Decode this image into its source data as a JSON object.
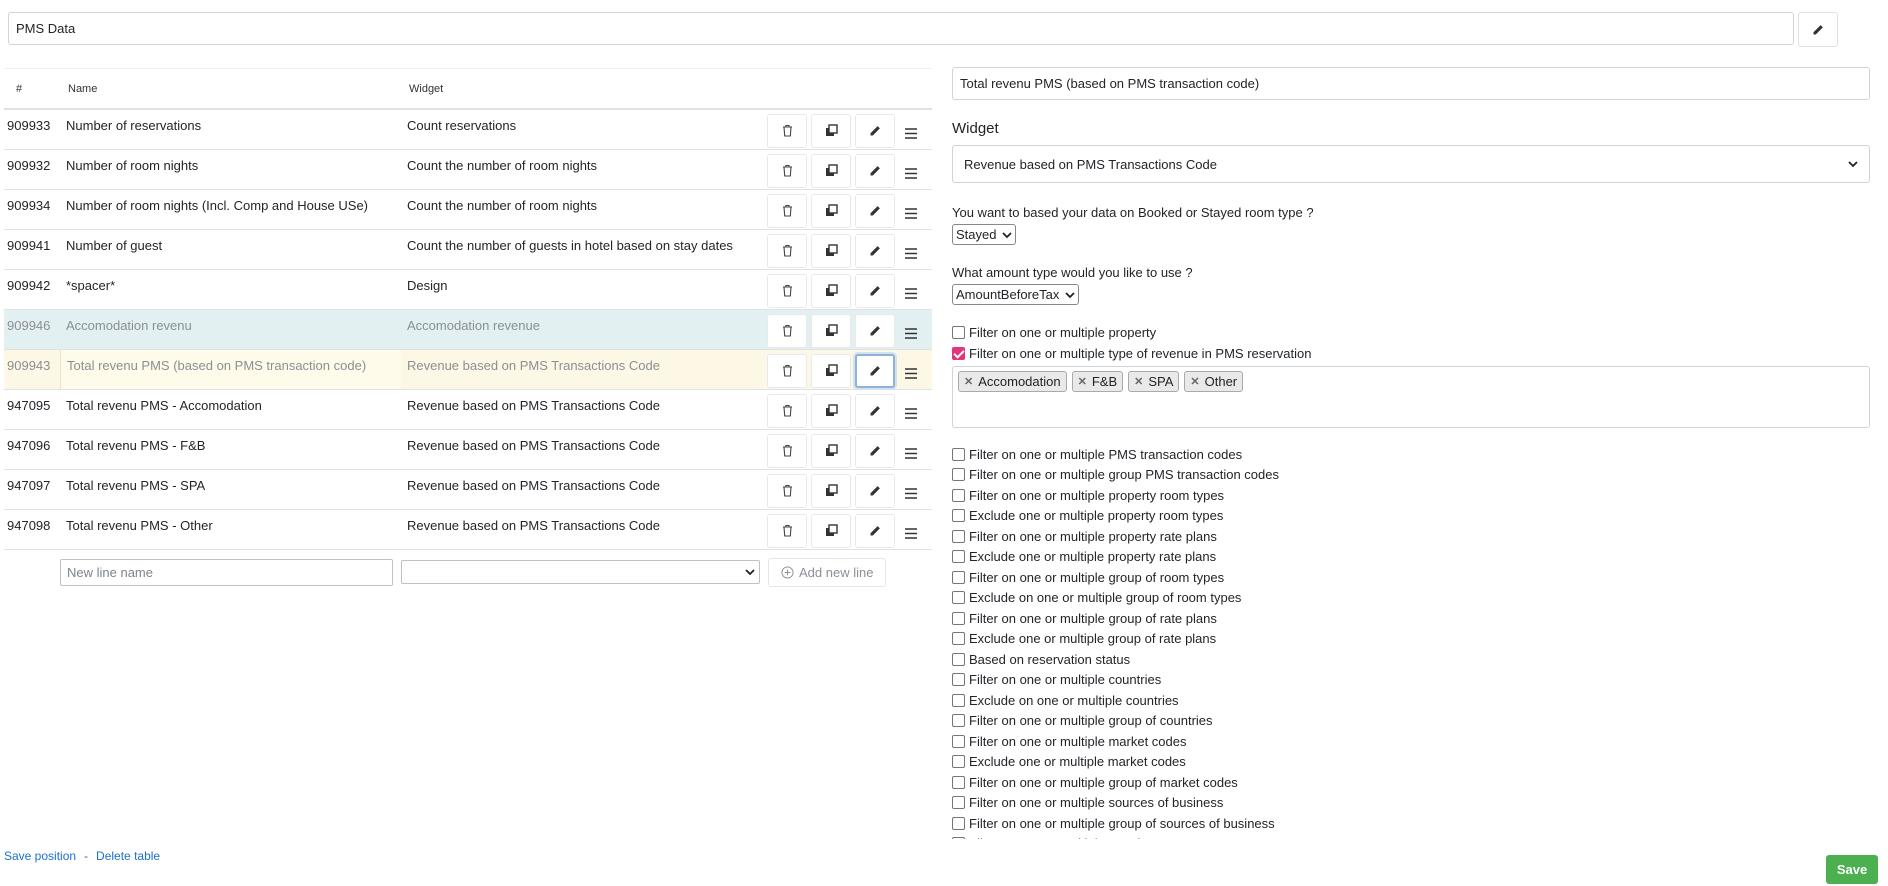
{
  "title": "PMS Data",
  "table": {
    "headers": {
      "id": "#",
      "name": "Name",
      "widget": "Widget"
    },
    "rows": [
      {
        "id": "909933",
        "name": "Number of reservations",
        "widget": "Count reservations",
        "state": ""
      },
      {
        "id": "909932",
        "name": "Number of room nights",
        "widget": "Count the number of room nights",
        "state": ""
      },
      {
        "id": "909934",
        "name": "Number of room nights (Incl. Comp and House USe)",
        "widget": "Count the number of room nights",
        "state": ""
      },
      {
        "id": "909941",
        "name": "Number of guest",
        "widget": "Count the number of guests in hotel based on stay dates",
        "state": ""
      },
      {
        "id": "909942",
        "name": "*spacer*",
        "widget": "Design",
        "state": ""
      },
      {
        "id": "909946",
        "name": "Accomodation revenu",
        "widget": "Accomodation revenue",
        "state": "ghost"
      },
      {
        "id": "909943",
        "name": "Total revenu PMS (based on PMS transaction code)",
        "widget": "Revenue based on PMS Transactions Code",
        "state": "editing"
      },
      {
        "id": "947095",
        "name": "Total revenu PMS - Accomodation",
        "widget": "Revenue based on PMS Transactions Code",
        "state": ""
      },
      {
        "id": "947096",
        "name": "Total revenu PMS - F&B",
        "widget": "Revenue based on PMS Transactions Code",
        "state": ""
      },
      {
        "id": "947097",
        "name": "Total revenu PMS - SPA",
        "widget": "Revenue based on PMS Transactions Code",
        "state": ""
      },
      {
        "id": "947098",
        "name": "Total revenu PMS - Other",
        "widget": "Revenue based on PMS Transactions Code",
        "state": ""
      }
    ],
    "new_line": {
      "placeholder": "New line name",
      "add_label": "Add new line"
    }
  },
  "footer": {
    "save_position": "Save position",
    "separator": "-",
    "delete_table": "Delete table",
    "save": "Save"
  },
  "editor": {
    "name_value": "Total revenu PMS (based on PMS transaction code)",
    "widget_label": "Widget",
    "widget_value": "Revenue based on PMS Transactions Code",
    "q_room_type": "You want to based your data on Booked or Stayed room type ?",
    "room_type_value": "Stayed",
    "q_amount": "What amount type would you like to use ?",
    "amount_value": "AmountBeforeTax",
    "filter_property": {
      "label": "Filter on one or multiple property",
      "checked": false
    },
    "filter_revenue_type": {
      "label": "Filter on one or multiple type of revenue in PMS reservation",
      "checked": true
    },
    "revenue_tags": [
      "Accomodation",
      "F&B",
      "SPA",
      "Other"
    ],
    "filters": [
      "Filter on one or multiple PMS transaction codes",
      "Filter on one or multiple group PMS transaction codes",
      "Filter on one or multiple property room types",
      "Exclude one or multiple property room types",
      "Filter on one or multiple property rate plans",
      "Exclude one or multiple property rate plans",
      "Filter on one or multiple group of room types",
      "Exclude on one or multiple group of room types",
      "Filter on one or multiple group of rate plans",
      "Exclude one or multiple group of rate plans",
      "Based on reservation status",
      "Filter on one or multiple countries",
      "Exclude on one or multiple countries",
      "Filter on one or multiple group of countries",
      "Filter on one or multiple market codes",
      "Exclude one or multiple market codes",
      "Filter on one or multiple group of market codes",
      "Filter on one or multiple sources of business",
      "Filter on one or multiple group of sources of business",
      "Filter on one or multiple travel reasons"
    ]
  }
}
